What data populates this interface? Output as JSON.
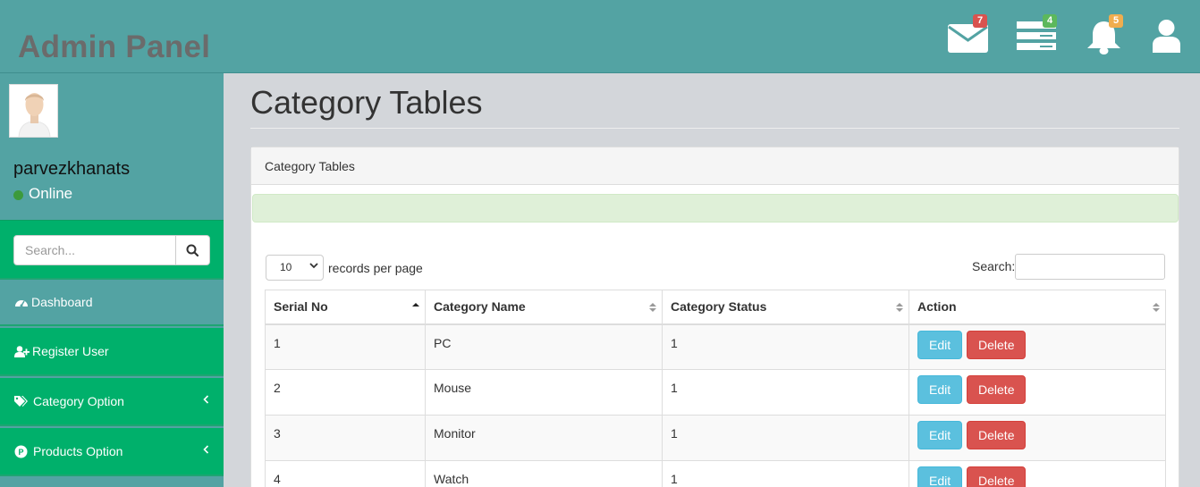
{
  "header": {
    "brand": "Admin Panel",
    "badges": {
      "messages": "7",
      "tasks": "4",
      "alerts": "5"
    }
  },
  "sidebar": {
    "username": "parvezkhanats",
    "status": "Online",
    "search_placeholder": "Search...",
    "items": [
      {
        "label": "Dashboard",
        "icon": "dashboard-icon"
      },
      {
        "label": "Register User",
        "icon": "user-plus-icon"
      },
      {
        "label": "Category Option",
        "icon": "tags-icon"
      },
      {
        "label": "Products Option",
        "icon": "product-p-icon"
      }
    ]
  },
  "main": {
    "title": "Category Tables",
    "panel_title": "Category Tables",
    "length_value": "10",
    "length_suffix": "records per page",
    "search_label": "Search:",
    "columns": [
      "Serial No",
      "Category Name",
      "Category Status",
      "Action"
    ],
    "rows": [
      {
        "serial": "1",
        "name": "PC",
        "status": "1"
      },
      {
        "serial": "2",
        "name": "Mouse",
        "status": "1"
      },
      {
        "serial": "3",
        "name": "Monitor",
        "status": "1"
      },
      {
        "serial": "4",
        "name": "Watch",
        "status": "1"
      }
    ],
    "edit_label": "Edit",
    "delete_label": "Delete"
  },
  "colors": {
    "header": "#53a3a3",
    "sidebar_green": "#00b06b",
    "edit": "#5bc0de",
    "delete": "#d9534f"
  }
}
